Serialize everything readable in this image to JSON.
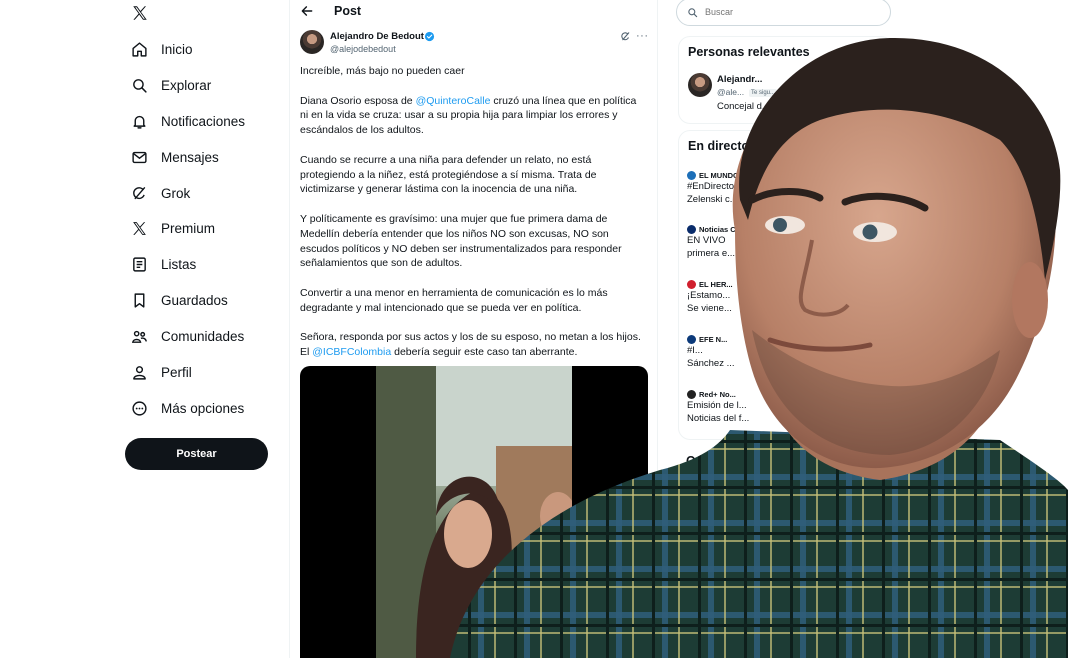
{
  "nav": {
    "items": [
      {
        "label": "Inicio",
        "icon": "home-icon"
      },
      {
        "label": "Explorar",
        "icon": "search-icon"
      },
      {
        "label": "Notificaciones",
        "icon": "bell-icon"
      },
      {
        "label": "Mensajes",
        "icon": "mail-icon"
      },
      {
        "label": "Grok",
        "icon": "grok-icon"
      },
      {
        "label": "Premium",
        "icon": "x-logo-icon"
      },
      {
        "label": "Listas",
        "icon": "list-icon"
      },
      {
        "label": "Guardados",
        "icon": "bookmark-icon"
      },
      {
        "label": "Comunidades",
        "icon": "community-icon"
      },
      {
        "label": "Perfil",
        "icon": "person-icon"
      },
      {
        "label": "Más opciones",
        "icon": "more-circle-icon"
      }
    ],
    "post_button": "Postear"
  },
  "header": {
    "title": "Post"
  },
  "post": {
    "author_name": "Alejandro De Bedout",
    "author_handle": "@alejodebedout",
    "p1": "Increíble, más bajo no pueden caer",
    "p2_pre": "Diana Osorio esposa de ",
    "p2_mention": "@QuinteroCalle",
    "p2_post_a": " cruzó una línea que en política",
    "p2_line2": "ni en la vida se cruza: usar a su propia hija para limpiar los errores y",
    "p2_line3": "escándalos de los adultos.",
    "p3_line1": "Cuando se recurre a una niña para defender un relato, no está",
    "p3_line2": "protegiendo a la niñez, está protegiéndose a sí misma. Trata de",
    "p3_line3": "victimizarse y generar lástima con la inocencia de una niña.",
    "p4_line1": "Y políticamente es gravísimo: una mujer que fue primera dama de",
    "p4_line2": "Medellín debería entender que los niños NO son excusas, NO son",
    "p4_line3": "escudos políticos y NO deben ser instrumentalizados para responder",
    "p4_line4": "señalamientos que son de adultos.",
    "p5_line1": "Convertir a una menor en herramienta de comunicación es lo más",
    "p5_line2": "degradante y mal intencionado que se pueda ver en política.",
    "p6_line1": "Señora, responda por sus actos y los de su esposo, no metan a los hijos.",
    "p6_pre": "El ",
    "p6_mention": "@ICBFColombia",
    "p6_post": " debería seguir este caso tan aberrante."
  },
  "search": {
    "placeholder": "Buscar"
  },
  "relevant": {
    "title": "Personas relevantes",
    "name": "Alejandr...",
    "handle": "@ale...",
    "badge": "Te sigu...",
    "bio": "Concejal d..."
  },
  "live": {
    "title": "En directo",
    "items": [
      {
        "source": "EL MUNDO",
        "line1": "#EnDirecto",
        "line2": "Zelenski c...",
        "color": "#1d6fb8"
      },
      {
        "source": "Noticias C...",
        "line1": "EN VIVO",
        "line2": "primera e...",
        "color": "#0a2c6b"
      },
      {
        "source": "EL HER...",
        "line1": "¡Estamo...",
        "line2": "Se viene...",
        "color": "#d01f2e"
      },
      {
        "source": "EFE N...",
        "line1": "#I...",
        "line2": "Sánchez ...",
        "color": "#0c3a7a"
      },
      {
        "source": "Red+ No...",
        "line1": "Emisión de l...",
        "line2": "Noticias del f...",
        "color": "#222222"
      }
    ]
  },
  "trends": {
    "title": "Qué está..."
  }
}
